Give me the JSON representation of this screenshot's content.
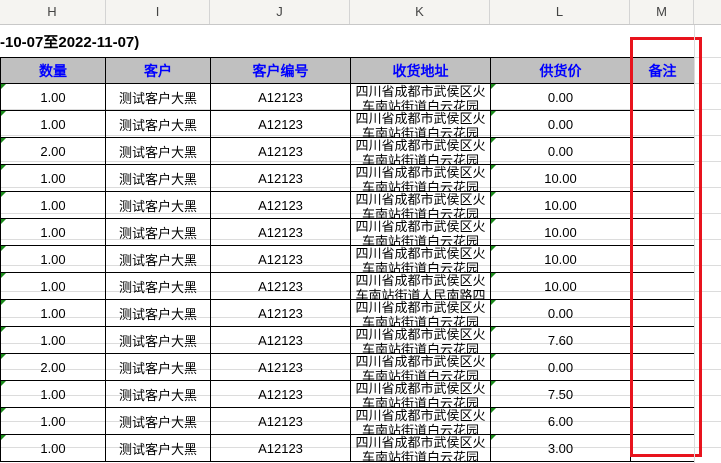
{
  "column_headers": [
    "H",
    "I",
    "J",
    "K",
    "L",
    "M"
  ],
  "title": "-10-07至2022-11-07)",
  "table": {
    "headers": [
      "数量",
      "客户",
      "客户编号",
      "收货地址",
      "供货价",
      "备注"
    ],
    "rows": [
      {
        "qty": "1.00",
        "customer": "测试客户大黑",
        "code": "A12123",
        "addr1": "四川省成都市武侯区火",
        "addr2": "车南站街道白云花园",
        "price": "0.00",
        "note": ""
      },
      {
        "qty": "1.00",
        "customer": "测试客户大黑",
        "code": "A12123",
        "addr1": "四川省成都市武侯区火",
        "addr2": "车南站街道白云花园",
        "price": "0.00",
        "note": ""
      },
      {
        "qty": "2.00",
        "customer": "测试客户大黑",
        "code": "A12123",
        "addr1": "四川省成都市武侯区火",
        "addr2": "车南站街道白云花园",
        "price": "0.00",
        "note": ""
      },
      {
        "qty": "1.00",
        "customer": "测试客户大黑",
        "code": "A12123",
        "addr1": "四川省成都市武侯区火",
        "addr2": "车南站街道白云花园",
        "price": "10.00",
        "note": ""
      },
      {
        "qty": "1.00",
        "customer": "测试客户大黑",
        "code": "A12123",
        "addr1": "四川省成都市武侯区火",
        "addr2": "车南站街道白云花园",
        "price": "10.00",
        "note": ""
      },
      {
        "qty": "1.00",
        "customer": "测试客户大黑",
        "code": "A12123",
        "addr1": "四川省成都市武侯区火",
        "addr2": "车南站街道白云花园",
        "price": "10.00",
        "note": ""
      },
      {
        "qty": "1.00",
        "customer": "测试客户大黑",
        "code": "A12123",
        "addr1": "四川省成都市武侯区火",
        "addr2": "车南站街道白云花园",
        "price": "10.00",
        "note": ""
      },
      {
        "qty": "1.00",
        "customer": "测试客户大黑",
        "code": "A12123",
        "addr1": "四川省成都市武侯区火",
        "addr2": "车南站街道人民南路四",
        "price": "10.00",
        "note": ""
      },
      {
        "qty": "1.00",
        "customer": "测试客户大黑",
        "code": "A12123",
        "addr1": "四川省成都市武侯区火",
        "addr2": "车南站街道白云花园",
        "price": "0.00",
        "note": ""
      },
      {
        "qty": "1.00",
        "customer": "测试客户大黑",
        "code": "A12123",
        "addr1": "四川省成都市武侯区火",
        "addr2": "车南站街道白云花园",
        "price": "7.60",
        "note": ""
      },
      {
        "qty": "2.00",
        "customer": "测试客户大黑",
        "code": "A12123",
        "addr1": "四川省成都市武侯区火",
        "addr2": "车南站街道白云花园",
        "price": "0.00",
        "note": ""
      },
      {
        "qty": "1.00",
        "customer": "测试客户大黑",
        "code": "A12123",
        "addr1": "四川省成都市武侯区火",
        "addr2": "车南站街道白云花园",
        "price": "7.50",
        "note": ""
      },
      {
        "qty": "1.00",
        "customer": "测试客户大黑",
        "code": "A12123",
        "addr1": "四川省成都市武侯区火",
        "addr2": "车南站街道白云花园",
        "price": "6.00",
        "note": ""
      },
      {
        "qty": "1.00",
        "customer": "测试客户大黑",
        "code": "A12123",
        "addr1": "四川省成都市武侯区火",
        "addr2": "车南站街道白云花园",
        "price": "3.00",
        "note": ""
      }
    ]
  },
  "colors": {
    "header_bg": "#c0c0c0",
    "header_text": "#0000ff",
    "highlight": "#e8131d",
    "number_marker": "#1a8a1a"
  }
}
